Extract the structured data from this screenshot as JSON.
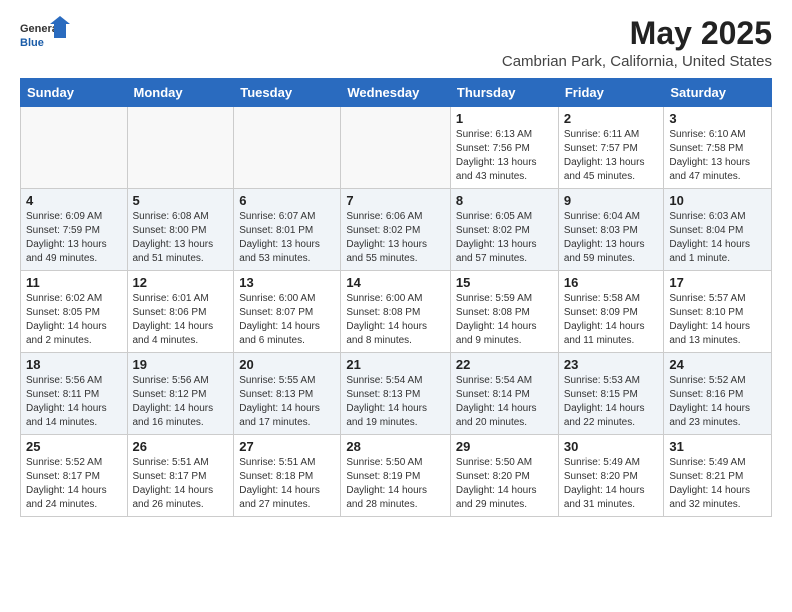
{
  "header": {
    "logo_general": "General",
    "logo_blue": "Blue",
    "main_title": "May 2025",
    "subtitle": "Cambrian Park, California, United States"
  },
  "calendar": {
    "days_of_week": [
      "Sunday",
      "Monday",
      "Tuesday",
      "Wednesday",
      "Thursday",
      "Friday",
      "Saturday"
    ],
    "weeks": [
      [
        {
          "day": "",
          "empty": true
        },
        {
          "day": "",
          "empty": true
        },
        {
          "day": "",
          "empty": true
        },
        {
          "day": "",
          "empty": true
        },
        {
          "day": "1",
          "sunrise": "6:13 AM",
          "sunset": "7:56 PM",
          "daylight": "13 hours and 43 minutes."
        },
        {
          "day": "2",
          "sunrise": "6:11 AM",
          "sunset": "7:57 PM",
          "daylight": "13 hours and 45 minutes."
        },
        {
          "day": "3",
          "sunrise": "6:10 AM",
          "sunset": "7:58 PM",
          "daylight": "13 hours and 47 minutes."
        }
      ],
      [
        {
          "day": "4",
          "sunrise": "6:09 AM",
          "sunset": "7:59 PM",
          "daylight": "13 hours and 49 minutes."
        },
        {
          "day": "5",
          "sunrise": "6:08 AM",
          "sunset": "8:00 PM",
          "daylight": "13 hours and 51 minutes."
        },
        {
          "day": "6",
          "sunrise": "6:07 AM",
          "sunset": "8:01 PM",
          "daylight": "13 hours and 53 minutes."
        },
        {
          "day": "7",
          "sunrise": "6:06 AM",
          "sunset": "8:02 PM",
          "daylight": "13 hours and 55 minutes."
        },
        {
          "day": "8",
          "sunrise": "6:05 AM",
          "sunset": "8:02 PM",
          "daylight": "13 hours and 57 minutes."
        },
        {
          "day": "9",
          "sunrise": "6:04 AM",
          "sunset": "8:03 PM",
          "daylight": "13 hours and 59 minutes."
        },
        {
          "day": "10",
          "sunrise": "6:03 AM",
          "sunset": "8:04 PM",
          "daylight": "14 hours and 1 minute."
        }
      ],
      [
        {
          "day": "11",
          "sunrise": "6:02 AM",
          "sunset": "8:05 PM",
          "daylight": "14 hours and 2 minutes."
        },
        {
          "day": "12",
          "sunrise": "6:01 AM",
          "sunset": "8:06 PM",
          "daylight": "14 hours and 4 minutes."
        },
        {
          "day": "13",
          "sunrise": "6:00 AM",
          "sunset": "8:07 PM",
          "daylight": "14 hours and 6 minutes."
        },
        {
          "day": "14",
          "sunrise": "6:00 AM",
          "sunset": "8:08 PM",
          "daylight": "14 hours and 8 minutes."
        },
        {
          "day": "15",
          "sunrise": "5:59 AM",
          "sunset": "8:08 PM",
          "daylight": "14 hours and 9 minutes."
        },
        {
          "day": "16",
          "sunrise": "5:58 AM",
          "sunset": "8:09 PM",
          "daylight": "14 hours and 11 minutes."
        },
        {
          "day": "17",
          "sunrise": "5:57 AM",
          "sunset": "8:10 PM",
          "daylight": "14 hours and 13 minutes."
        }
      ],
      [
        {
          "day": "18",
          "sunrise": "5:56 AM",
          "sunset": "8:11 PM",
          "daylight": "14 hours and 14 minutes."
        },
        {
          "day": "19",
          "sunrise": "5:56 AM",
          "sunset": "8:12 PM",
          "daylight": "14 hours and 16 minutes."
        },
        {
          "day": "20",
          "sunrise": "5:55 AM",
          "sunset": "8:13 PM",
          "daylight": "14 hours and 17 minutes."
        },
        {
          "day": "21",
          "sunrise": "5:54 AM",
          "sunset": "8:13 PM",
          "daylight": "14 hours and 19 minutes."
        },
        {
          "day": "22",
          "sunrise": "5:54 AM",
          "sunset": "8:14 PM",
          "daylight": "14 hours and 20 minutes."
        },
        {
          "day": "23",
          "sunrise": "5:53 AM",
          "sunset": "8:15 PM",
          "daylight": "14 hours and 22 minutes."
        },
        {
          "day": "24",
          "sunrise": "5:52 AM",
          "sunset": "8:16 PM",
          "daylight": "14 hours and 23 minutes."
        }
      ],
      [
        {
          "day": "25",
          "sunrise": "5:52 AM",
          "sunset": "8:17 PM",
          "daylight": "14 hours and 24 minutes."
        },
        {
          "day": "26",
          "sunrise": "5:51 AM",
          "sunset": "8:17 PM",
          "daylight": "14 hours and 26 minutes."
        },
        {
          "day": "27",
          "sunrise": "5:51 AM",
          "sunset": "8:18 PM",
          "daylight": "14 hours and 27 minutes."
        },
        {
          "day": "28",
          "sunrise": "5:50 AM",
          "sunset": "8:19 PM",
          "daylight": "14 hours and 28 minutes."
        },
        {
          "day": "29",
          "sunrise": "5:50 AM",
          "sunset": "8:20 PM",
          "daylight": "14 hours and 29 minutes."
        },
        {
          "day": "30",
          "sunrise": "5:49 AM",
          "sunset": "8:20 PM",
          "daylight": "14 hours and 31 minutes."
        },
        {
          "day": "31",
          "sunrise": "5:49 AM",
          "sunset": "8:21 PM",
          "daylight": "14 hours and 32 minutes."
        }
      ]
    ]
  }
}
